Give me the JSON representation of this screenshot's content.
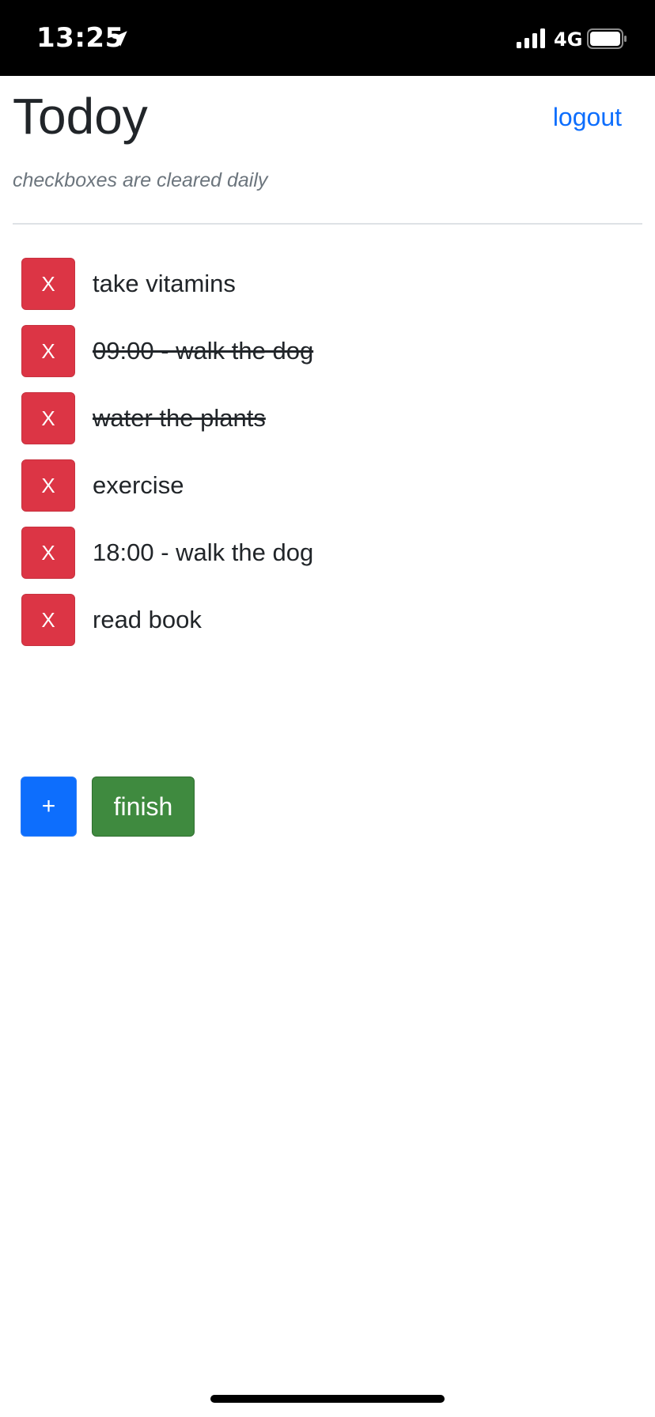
{
  "status_bar": {
    "time": "13:25",
    "network": "4G",
    "icons": [
      "location-arrow-icon",
      "signal-bars-icon",
      "battery-icon"
    ]
  },
  "header": {
    "title": "Todoy",
    "logout_label": "logout",
    "subtitle": "checkboxes are cleared daily"
  },
  "tasks": [
    {
      "delete_label": "X",
      "label": "take vitamins",
      "done": false
    },
    {
      "delete_label": "X",
      "label": "09:00 - walk the dog",
      "done": true
    },
    {
      "delete_label": "X",
      "label": "water the plants",
      "done": true
    },
    {
      "delete_label": "X",
      "label": "exercise",
      "done": false
    },
    {
      "delete_label": "X",
      "label": "18:00 - walk the dog",
      "done": false
    },
    {
      "delete_label": "X",
      "label": "read book",
      "done": false
    }
  ],
  "actions": {
    "add_label": "+",
    "finish_label": "finish"
  },
  "colors": {
    "delete": "#dc3545",
    "add": "#0d6efd",
    "finish": "#3f8a3f",
    "link": "#0d6efd"
  }
}
